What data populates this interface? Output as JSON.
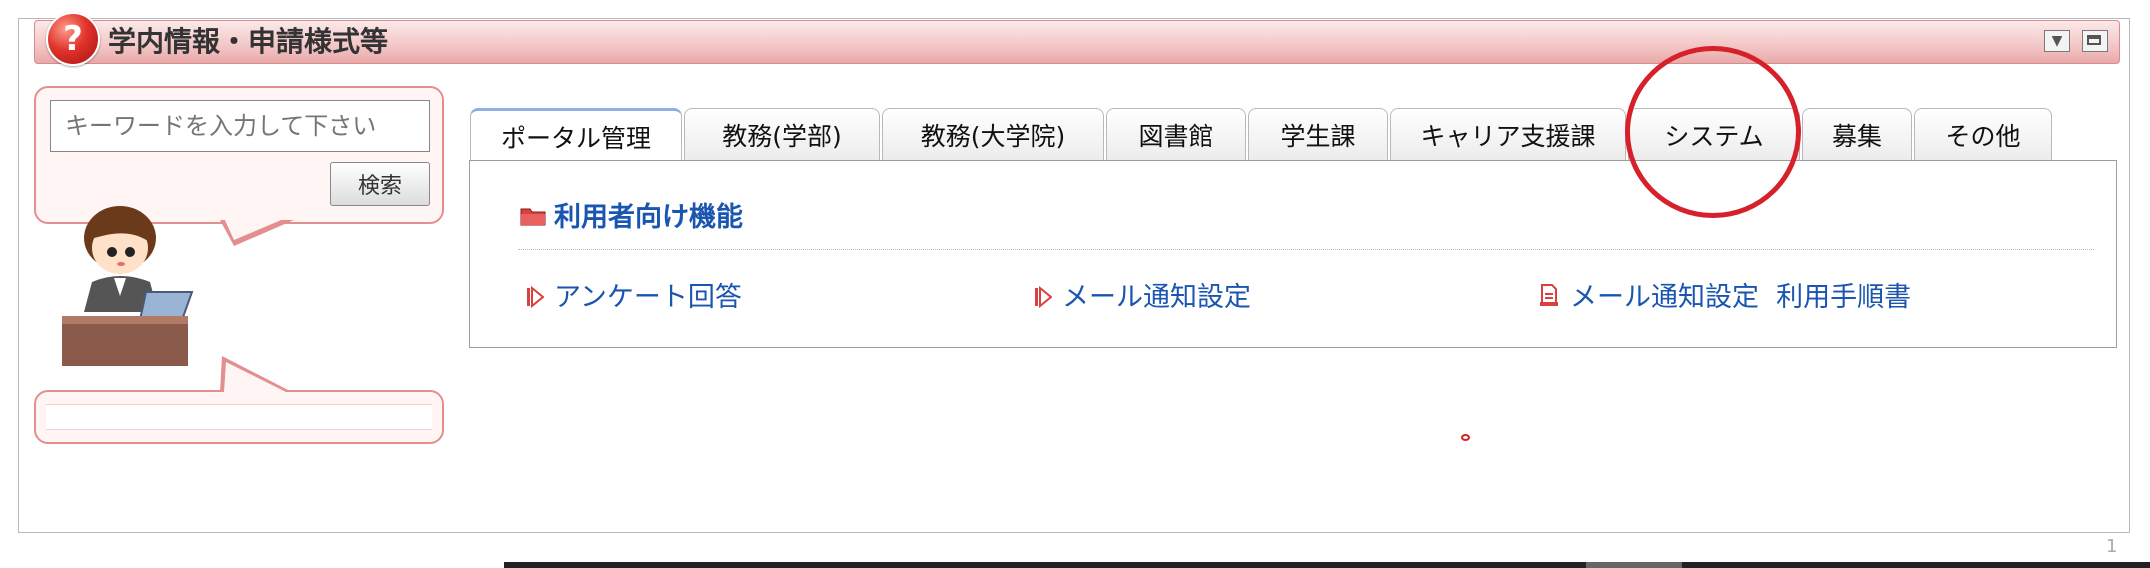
{
  "header": {
    "title": "学内情報・申請様式等",
    "icon": "question-icon"
  },
  "search": {
    "placeholder": "キーワードを入力して下さい",
    "button_label": "検索"
  },
  "tabs": [
    {
      "label": "ポータル管理",
      "active": true
    },
    {
      "label": "教務(学部)",
      "active": false
    },
    {
      "label": "教務(大学院)",
      "active": false
    },
    {
      "label": "図書館",
      "active": false
    },
    {
      "label": "学生課",
      "active": false
    },
    {
      "label": "キャリア支援課",
      "active": false
    },
    {
      "label": "システム",
      "active": false
    },
    {
      "label": "募集",
      "active": false
    },
    {
      "label": "その他",
      "active": false
    }
  ],
  "content": {
    "section_title": "利用者向け機能",
    "links": [
      {
        "label": "アンケート回答",
        "icon": "arrow-icon"
      },
      {
        "label": "メール通知設定",
        "icon": "arrow-icon"
      },
      {
        "label": "メール通知設定  利用手順書",
        "icon": "document-icon"
      }
    ]
  },
  "footer": {
    "page_number": "1"
  },
  "colors": {
    "accent": "#1a55b0",
    "header_pink": "#f4c9c9",
    "highlight_red": "#d6202a"
  }
}
